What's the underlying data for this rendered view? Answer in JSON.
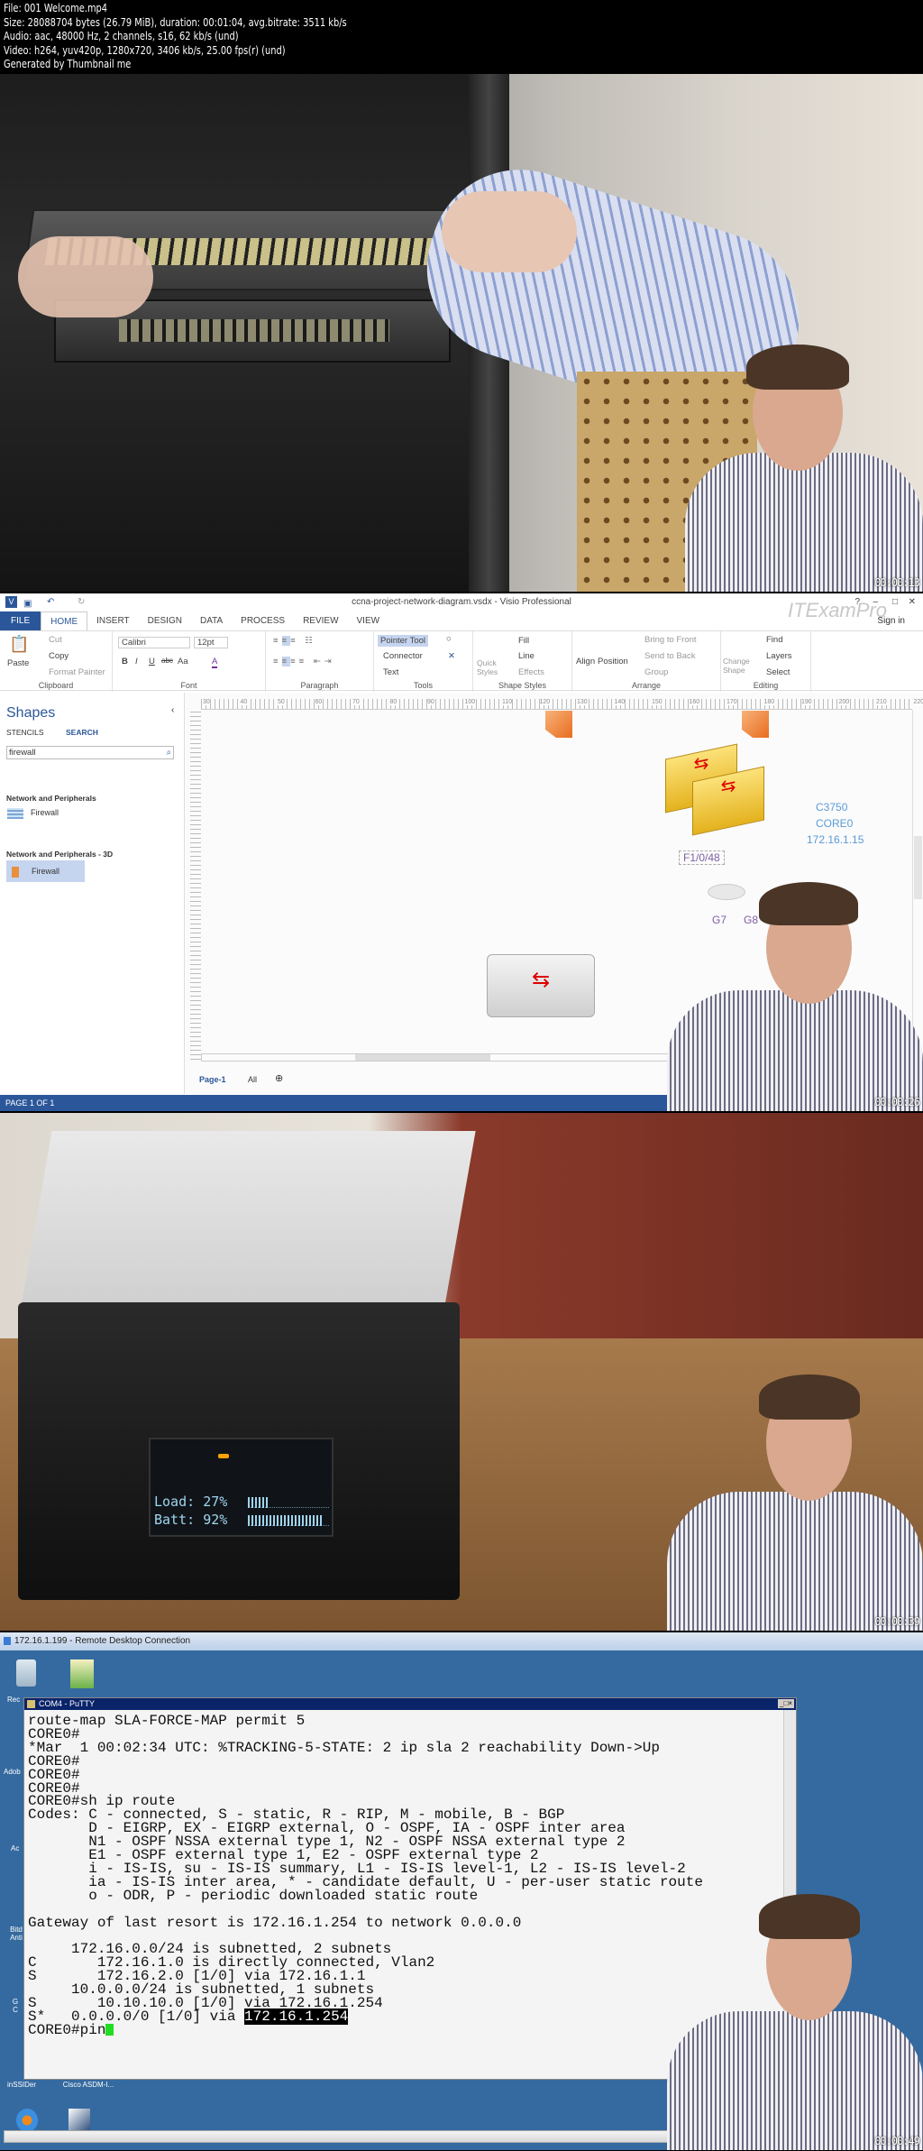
{
  "header": {
    "file": "File: 001 Welcome.mp4",
    "size": "Size: 28088704 bytes (26.79 MiB), duration: 00:01:04, avg.bitrate: 3511 kb/s",
    "audio": "Audio: aac, 48000 Hz, 2 channels, s16, 62 kb/s (und)",
    "video": "Video: h264, yuv420p, 1280x720, 3406 kb/s, 25.00 fps(r) (und)",
    "generator": "Generated by Thumbnail me"
  },
  "frames": [
    {
      "timestamp": "00:00:13"
    },
    {
      "timestamp": "00:00:26"
    },
    {
      "timestamp": "00:00:39"
    },
    {
      "timestamp": "00:00:49"
    }
  ],
  "visio": {
    "title": "ccna-project-network-diagram.vsdx - Visio Professional",
    "window_controls": [
      "?",
      "–",
      "□",
      "✕"
    ],
    "sign_in": "Sign in",
    "watermark": "ITExamPro",
    "tabs": [
      "FILE",
      "HOME",
      "INSERT",
      "DESIGN",
      "DATA",
      "PROCESS",
      "REVIEW",
      "VIEW"
    ],
    "active_tab": "HOME",
    "clipboard": {
      "paste": "Paste",
      "cut": "Cut",
      "copy": "Copy",
      "format_painter": "Format Painter",
      "label": "Clipboard"
    },
    "font": {
      "name": "Calibri",
      "size": "12pt",
      "label": "Font",
      "bold": "B",
      "italic": "I",
      "underline": "U",
      "strike": "abc",
      "case": "Aa",
      "color": "A"
    },
    "paragraph": {
      "label": "Paragraph"
    },
    "tools": {
      "pointer": "Pointer Tool",
      "connector": "Connector",
      "text": "Text",
      "label": "Tools"
    },
    "shape_styles": {
      "quick_styles": "Quick Styles",
      "fill": "Fill",
      "line": "Line",
      "effects": "Effects",
      "label": "Shape Styles"
    },
    "arrange": {
      "align": "Align",
      "position": "Position",
      "bring_to_front": "Bring to Front",
      "send_to_back": "Send to Back",
      "group": "Group",
      "label": "Arrange"
    },
    "editing": {
      "change_shape": "Change Shape",
      "find": "Find",
      "layers": "Layers",
      "select": "Select",
      "label": "Editing"
    },
    "shapes_pane": {
      "title": "Shapes",
      "tab_stencils": "STENCILS",
      "tab_search": "SEARCH",
      "search_value": "firewall",
      "groups": [
        {
          "name": "Network and Peripherals",
          "item": "Firewall"
        },
        {
          "name": "Network and Peripherals - 3D",
          "item": "Firewall"
        }
      ]
    },
    "ruler_ticks": [
      "30",
      "40",
      "50",
      "60",
      "70",
      "80",
      "90",
      "100",
      "110",
      "120",
      "130",
      "140",
      "150",
      "160",
      "170",
      "180",
      "190",
      "200",
      "210",
      "220"
    ],
    "diagram": {
      "switch_model": "C3750",
      "switch_name": "CORE0",
      "switch_ip": "172.16.1.15",
      "port_label": "F1/0/48",
      "g7": "G7",
      "g8": "G8"
    },
    "page_tab": "Page-1",
    "all_tab": "All",
    "status": "PAGE 1 OF 1"
  },
  "ups": {
    "load_label": "Load:",
    "load_value": "27%",
    "load_fraction": 0.27,
    "batt_label": "Batt:",
    "batt_value": "92%",
    "batt_fraction": 0.92
  },
  "rdp": {
    "title": "172.16.1.199 - Remote Desktop Connection",
    "desktop_icons": [
      "Rec",
      "Adob",
      "Ac",
      "Bitd Anti",
      "G C",
      "inSSIDer",
      "Cisco ASDM-I..."
    ],
    "putty_title": "COM4 - PuTTY",
    "terminal_lines": [
      "route-map SLA-FORCE-MAP permit 5",
      "CORE0#",
      "*Mar  1 00:02:34 UTC: %TRACKING-5-STATE: 2 ip sla 2 reachability Down->Up",
      "CORE0#",
      "CORE0#",
      "CORE0#",
      "CORE0#sh ip route",
      "Codes: C - connected, S - static, R - RIP, M - mobile, B - BGP",
      "       D - EIGRP, EX - EIGRP external, O - OSPF, IA - OSPF inter area",
      "       N1 - OSPF NSSA external type 1, N2 - OSPF NSSA external type 2",
      "       E1 - OSPF external type 1, E2 - OSPF external type 2",
      "       i - IS-IS, su - IS-IS summary, L1 - IS-IS level-1, L2 - IS-IS level-2",
      "       ia - IS-IS inter area, * - candidate default, U - per-user static route",
      "       o - ODR, P - periodic downloaded static route",
      "",
      "Gateway of last resort is 172.16.1.254 to network 0.0.0.0",
      "",
      "     172.16.0.0/24 is subnetted, 2 subnets",
      "C       172.16.1.0 is directly connected, Vlan2",
      "S       172.16.2.0 [1/0] via 172.16.1.1",
      "     10.0.0.0/24 is subnetted, 1 subnets",
      "S       10.10.10.0 [1/0] via 172.16.1.254"
    ],
    "default_route_prefix": "S*   0.0.0.0/0 [1/0] via ",
    "default_route_highlight": "172.16.1.254",
    "prompt": "CORE0#pin"
  }
}
